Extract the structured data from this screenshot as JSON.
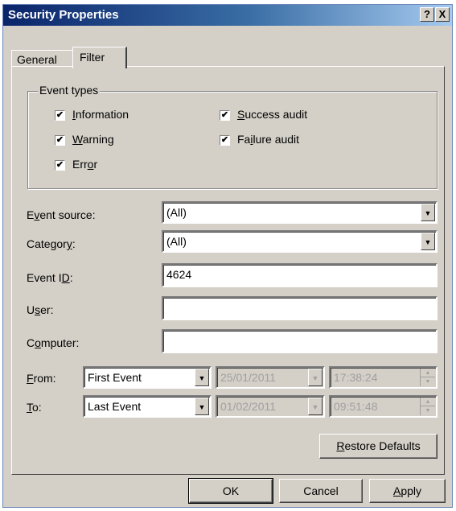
{
  "window": {
    "title": "Security Properties",
    "help_btn": "?",
    "close_btn": "X"
  },
  "tabs": [
    {
      "label": "General",
      "active": false
    },
    {
      "label": "Filter",
      "active": true
    }
  ],
  "event_types": {
    "legend": "Event types",
    "information": {
      "pre": "",
      "key": "I",
      "post": "nformation",
      "checked": true
    },
    "warning": {
      "pre": "",
      "key": "W",
      "post": "arning",
      "checked": true
    },
    "error": {
      "pre": "Err",
      "key": "o",
      "post": "r",
      "checked": true
    },
    "success_audit": {
      "pre": "",
      "key": "S",
      "post": "uccess audit",
      "checked": true
    },
    "failure_audit": {
      "pre": "Fa",
      "key": "i",
      "post": "lure audit",
      "checked": true
    },
    "check_mark": "✔"
  },
  "filters": {
    "event_source": {
      "pre": "E",
      "key": "v",
      "post": "ent source:",
      "value": "(All)"
    },
    "category": {
      "pre": "Categor",
      "key": "y",
      "post": ":",
      "value": "(All)"
    },
    "event_id": {
      "pre": "Event I",
      "key": "D",
      "post": ":",
      "value": "4624"
    },
    "user": {
      "pre": "U",
      "key": "s",
      "post": "er:",
      "value": ""
    },
    "computer": {
      "pre": "C",
      "key": "o",
      "post": "mputer:",
      "value": ""
    }
  },
  "from": {
    "pre": "",
    "key": "F",
    "post": "rom:",
    "select": "First Event",
    "date": "25/01/2011",
    "time": "17:38:24"
  },
  "to": {
    "pre": "",
    "key": "T",
    "post": "o:",
    "select": "Last Event",
    "date": "01/02/2011",
    "time": "09:51:48"
  },
  "buttons": {
    "restore": {
      "pre": "",
      "key": "R",
      "post": "estore Defaults"
    },
    "ok": "OK",
    "cancel": "Cancel",
    "apply": {
      "pre": "",
      "key": "A",
      "post": "pply"
    }
  },
  "icons": {
    "dropdown": "▼",
    "spin_up": "▲",
    "spin_down": "▼"
  }
}
